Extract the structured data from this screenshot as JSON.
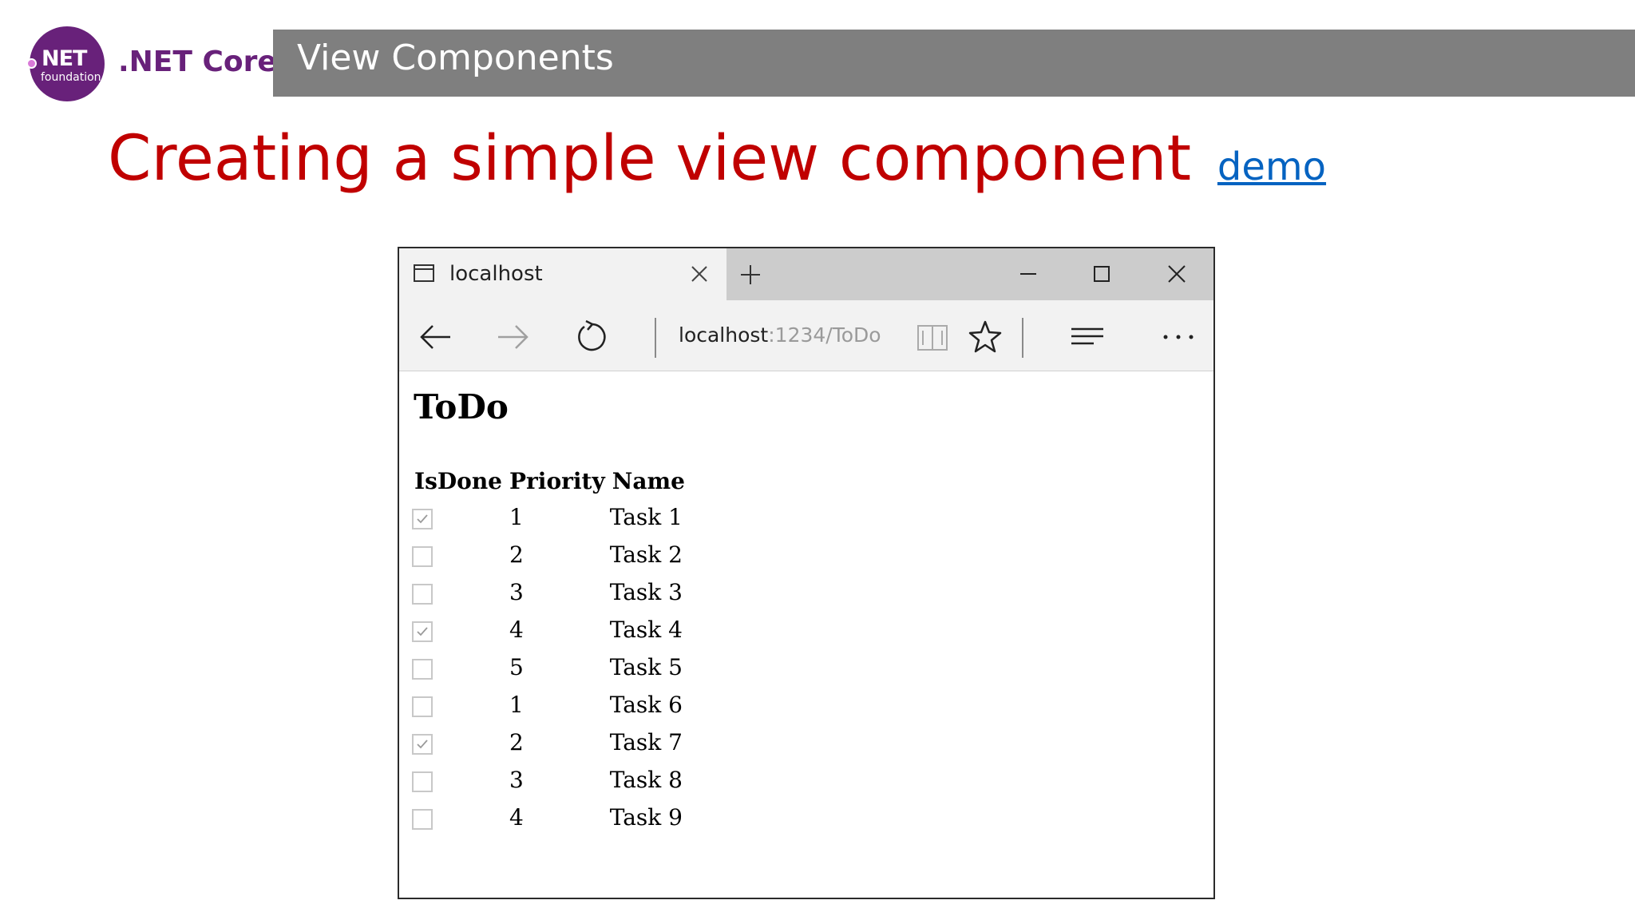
{
  "header": {
    "logo_net": "NET",
    "logo_foundation": "foundation",
    "brand": ".NET Core",
    "section_title": "View Components"
  },
  "slide": {
    "title": "Creating a simple view component",
    "link_label": "demo"
  },
  "browser": {
    "tab_title": "localhost",
    "address_host": "localhost",
    "address_path": ":1234/ToDo",
    "icons": {
      "tab_page": "page-icon",
      "tab_close": "close-icon",
      "new_tab": "plus-icon",
      "minimize": "minimize-icon",
      "maximize": "maximize-icon",
      "close": "close-icon",
      "back": "arrow-left-icon",
      "forward": "arrow-right-icon",
      "refresh": "refresh-icon",
      "reading_view": "book-icon",
      "favorites": "star-icon",
      "hub": "hub-lines-icon",
      "more": "ellipsis-icon"
    }
  },
  "page": {
    "title": "ToDo",
    "columns": [
      "IsDone",
      "Priority",
      "Name"
    ],
    "rows": [
      {
        "done": true,
        "priority": "1",
        "name": "Task 1"
      },
      {
        "done": false,
        "priority": "2",
        "name": "Task 2"
      },
      {
        "done": false,
        "priority": "3",
        "name": "Task 3"
      },
      {
        "done": true,
        "priority": "4",
        "name": "Task 4"
      },
      {
        "done": false,
        "priority": "5",
        "name": "Task 5"
      },
      {
        "done": false,
        "priority": "1",
        "name": "Task 6"
      },
      {
        "done": true,
        "priority": "2",
        "name": "Task 7"
      },
      {
        "done": false,
        "priority": "3",
        "name": "Task 8"
      },
      {
        "done": false,
        "priority": "4",
        "name": "Task 9"
      }
    ]
  },
  "colors": {
    "brand_purple": "#68217a",
    "title_red": "#c00000",
    "header_gray": "#7f7f7f",
    "link_blue": "#0563c1"
  }
}
